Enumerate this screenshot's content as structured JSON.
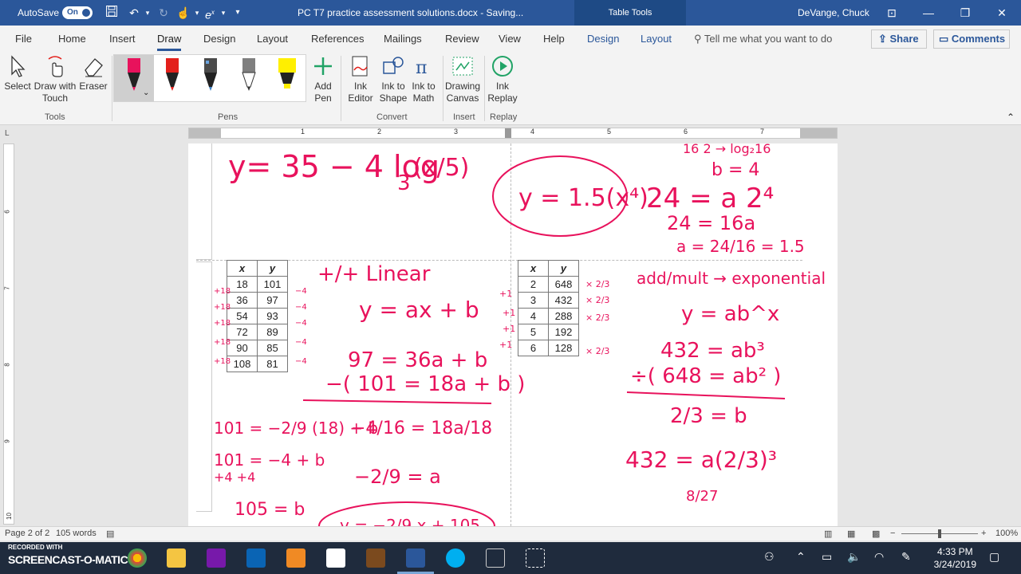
{
  "titlebar": {
    "autosave_label": "AutoSave",
    "autosave_state": "On",
    "doc_title": "PC T7 practice assessment solutions.docx  -  Saving...",
    "context_label": "Table Tools",
    "user": "DeVange, Chuck"
  },
  "tabs": [
    "File",
    "Home",
    "Insert",
    "Draw",
    "Design",
    "Layout",
    "References",
    "Mailings",
    "Review",
    "View",
    "Help"
  ],
  "active_tab": "Draw",
  "context_tabs": [
    "Design",
    "Layout"
  ],
  "tell_me": "Tell me what you want to do",
  "share_label": "Share",
  "comments_label": "Comments",
  "ribbon": {
    "tools": {
      "select": "Select",
      "draw_touch": "Draw with Touch",
      "eraser": "Eraser",
      "group": "Tools"
    },
    "pens_group": "Pens",
    "add_pen": "Add Pen",
    "convert": {
      "ink_editor": "Ink Editor",
      "ink_to_shape": "Ink to Shape",
      "ink_to_math": "Ink to Math",
      "group": "Convert"
    },
    "insert": {
      "drawing_canvas": "Drawing Canvas",
      "group": "Insert"
    },
    "replay": {
      "ink_replay": "Ink Replay",
      "group": "Replay"
    },
    "pen_colors": [
      "#e8125c",
      "#e3201b",
      "#4b4b4b",
      "#7f7f7f",
      "#ffef00"
    ]
  },
  "ruler": {
    "h_numbers": [
      "1",
      "2",
      "3",
      "4",
      "5",
      "6",
      "7"
    ],
    "v_numbers": [
      "6",
      "7",
      "8",
      "9",
      "10"
    ]
  },
  "tables": {
    "left": {
      "headers": [
        "x",
        "y"
      ],
      "rows": [
        [
          "18",
          "101"
        ],
        [
          "36",
          "97"
        ],
        [
          "54",
          "93"
        ],
        [
          "72",
          "89"
        ],
        [
          "90",
          "85"
        ],
        [
          "108",
          "81"
        ]
      ]
    },
    "right": {
      "headers": [
        "x",
        "y"
      ],
      "rows": [
        [
          "2",
          "648"
        ],
        [
          "3",
          "432"
        ],
        [
          "4",
          "288"
        ],
        [
          "5",
          "192"
        ],
        [
          "6",
          "128"
        ]
      ]
    }
  },
  "ink": {
    "top_left_eq": "y= 35 − 4 log",
    "top_left_base": "3",
    "top_left_arg": "(x/5)",
    "top_circled": "y = 1.5(x⁴)",
    "top_right_work": [
      "16   2  → log₂16",
      "b = 4",
      "24 = a 2⁴",
      "24 = 16a",
      "a = 24/16 = 1.5"
    ],
    "linear_label": "+/+     Linear",
    "linear_model": "y = ax + b",
    "linear_eq1": "97 = 36a + b",
    "linear_eq2": "−( 101 = 18a + b )",
    "linear_solve": [
      "−4/16 = 18a/18",
      "−2/9 = a"
    ],
    "left_work": [
      "101 = −2/9 (18) + b",
      "101 = −4 + b",
      "+4      +4",
      "105 = b"
    ],
    "final_linear": "y = −2/9 x + 105",
    "exp_label": "add/mult → exponential",
    "exp_model": "y = ab^x",
    "exp_eq1": "432 = ab³",
    "exp_eq2": "÷( 648 = ab² )",
    "exp_ratio": "2/3 = b",
    "exp_sub": "432 = a(2/3)³",
    "exp_frac": "8/27",
    "left_marks": [
      "+18",
      "+18",
      "+18",
      "+18",
      "+18"
    ],
    "left_diffs": [
      "−4",
      "−4",
      "−4",
      "−4",
      "−4"
    ],
    "right_marks": [
      "+1",
      "+1",
      "+1",
      "+1"
    ],
    "right_ratios": [
      "× 2/3",
      "× 2/3",
      "× 2/3",
      "× 2/3"
    ],
    "ink_color": "#e8125c"
  },
  "status": {
    "page": "Page 2 of 2",
    "words": "105 words",
    "zoom": "100%"
  },
  "taskbar": {
    "recorded_with": "RECORDED WITH",
    "screencast": "SCREENCAST-O-MATIC",
    "time": "4:33 PM",
    "date": "3/24/2019"
  }
}
